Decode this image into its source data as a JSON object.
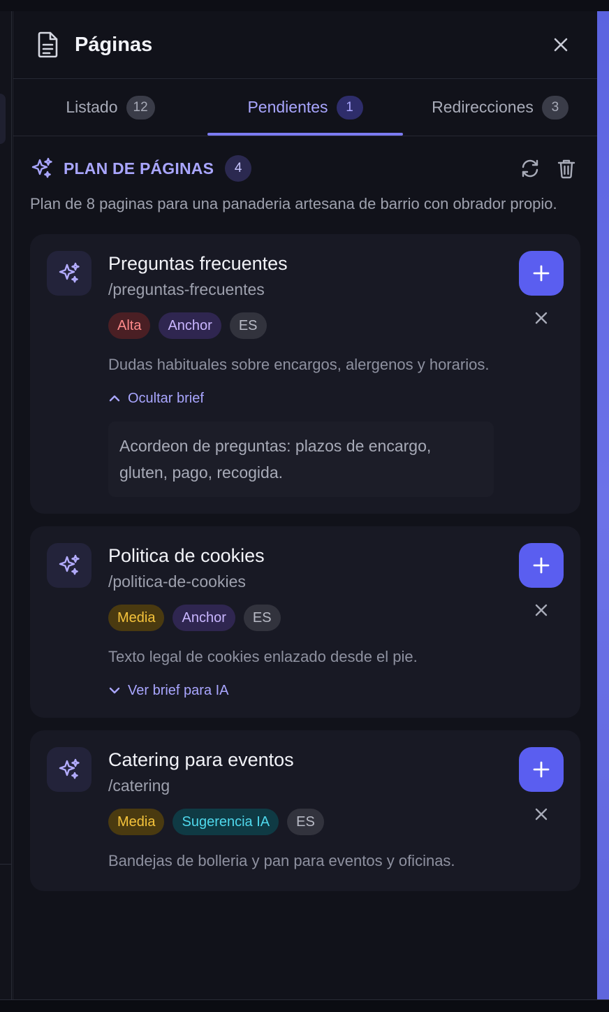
{
  "header": {
    "title": "Páginas",
    "doc_icon": "document-icon",
    "close_icon": "close-icon"
  },
  "tabs": [
    {
      "label": "Listado",
      "count": "12",
      "active": false
    },
    {
      "label": "Pendientes",
      "count": "1",
      "active": true
    },
    {
      "label": "Redirecciones",
      "count": "3",
      "active": false
    }
  ],
  "plan": {
    "title": "PLAN DE PÁGINAS",
    "count": "4",
    "description": "Plan de 8 paginas para una panaderia artesana de barrio con obrador propio.",
    "refresh_icon": "refresh-icon",
    "delete_icon": "trash-icon"
  },
  "cards": [
    {
      "name": "Preguntas frecuentes",
      "slug": "/preguntas-frecuentes",
      "tags": [
        {
          "label": "Alta",
          "kind": "alta"
        },
        {
          "label": "Anchor",
          "kind": "anchor"
        },
        {
          "label": "ES",
          "kind": "lang"
        }
      ],
      "description": "Dudas habituales sobre encargos, alergenos y horarios.",
      "toggle_label": "Ocultar brief",
      "expanded": true,
      "brief": "Acordeon de preguntas: plazos de encargo, gluten, pago, recogida."
    },
    {
      "name": "Politica de cookies",
      "slug": "/politica-de-cookies",
      "tags": [
        {
          "label": "Media",
          "kind": "media"
        },
        {
          "label": "Anchor",
          "kind": "anchor"
        },
        {
          "label": "ES",
          "kind": "lang"
        }
      ],
      "description": "Texto legal de cookies enlazado desde el pie.",
      "toggle_label": "Ver brief para IA",
      "expanded": false,
      "brief": ""
    },
    {
      "name": "Catering para eventos",
      "slug": "/catering",
      "tags": [
        {
          "label": "Media",
          "kind": "media"
        },
        {
          "label": "Sugerencia IA",
          "kind": "ia"
        },
        {
          "label": "ES",
          "kind": "lang"
        }
      ],
      "description": "Bandejas de bolleria y pan para eventos y oficinas.",
      "toggle_label": "",
      "expanded": false,
      "brief": ""
    }
  ],
  "colors": {
    "accent": "#7c7bf2",
    "add_button": "#5a5ef0",
    "panel_bg": "#11121a",
    "card_bg": "#181924"
  }
}
